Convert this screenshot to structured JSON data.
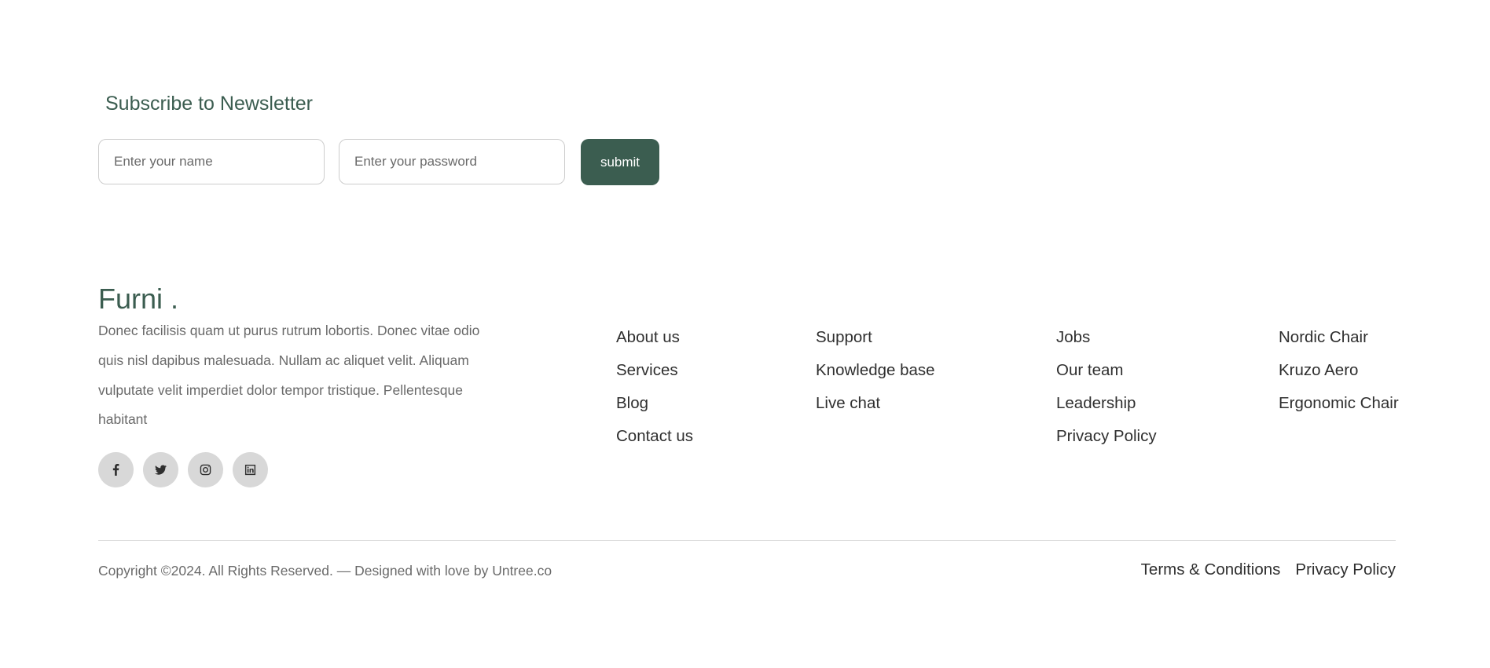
{
  "newsletter": {
    "title": "Subscribe to Newsletter",
    "name_placeholder": "Enter your name",
    "password_placeholder": "Enter your password",
    "submit_label": "submit"
  },
  "footer": {
    "logo": "Furni .",
    "description": "Donec facilisis quam ut purus rutrum lobortis. Donec vitae odio quis nisl dapibus malesuada. Nullam ac aliquet velit. Aliquam vulputate velit imperdiet dolor tempor tristique. Pellentesque habitant",
    "socials": [
      "facebook-icon",
      "twitter-icon",
      "instagram-icon",
      "linkedin-icon"
    ],
    "columns": [
      [
        "About us",
        "Services",
        "Blog",
        "Contact us"
      ],
      [
        "Support",
        "Knowledge base",
        "Live chat"
      ],
      [
        "Jobs",
        "Our team",
        "Leadership",
        "Privacy Policy"
      ],
      [
        "Nordic Chair",
        "Kruzo Aero",
        "Ergonomic Chair"
      ]
    ],
    "copyright": "Copyright ©2024. All Rights Reserved. — Designed with love by Untree.co",
    "legal": [
      "Terms & Conditions",
      "Privacy Policy"
    ]
  },
  "colors": {
    "brand": "#3b5d50",
    "text_muted": "#6a6a6a",
    "text_dark": "#2f2f2f",
    "social_bg": "#d8d8d8"
  }
}
